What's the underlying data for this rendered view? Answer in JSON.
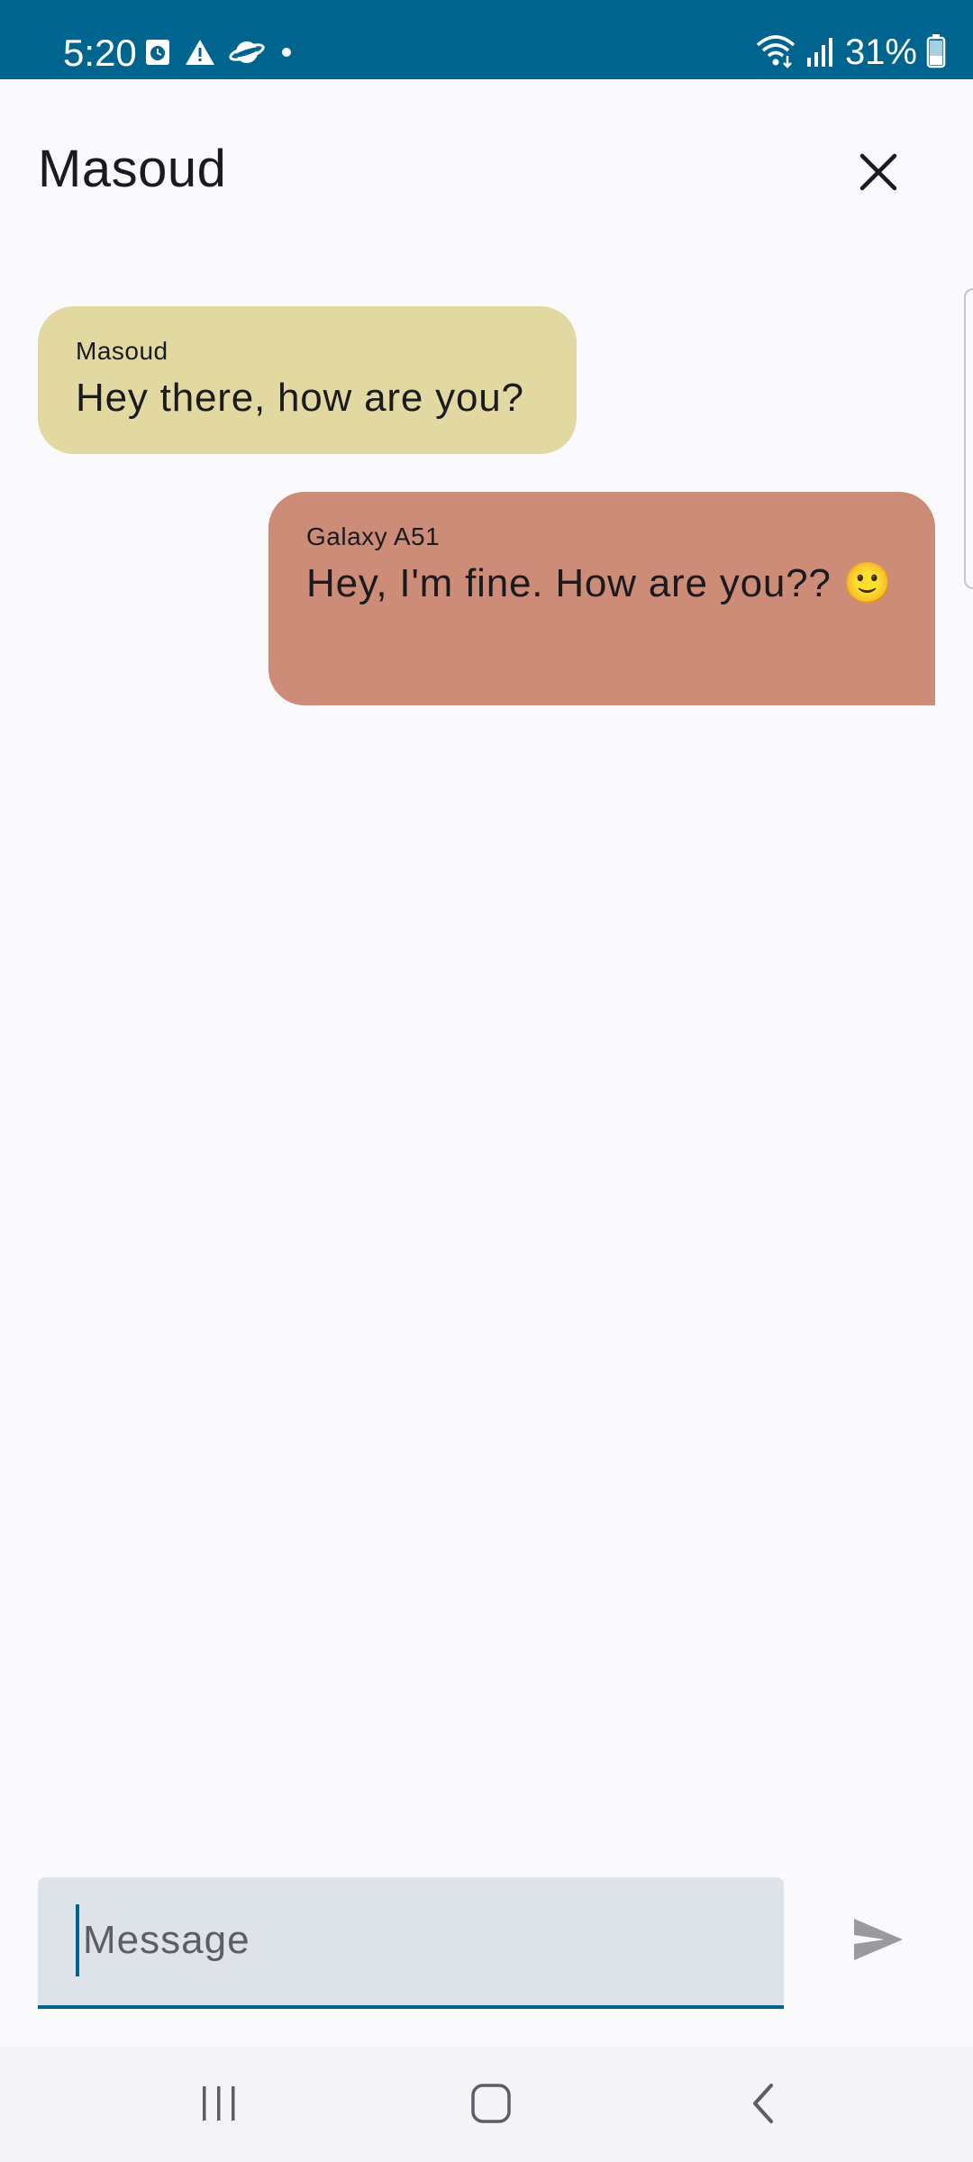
{
  "status_bar": {
    "time": "5:20",
    "battery": "31%",
    "icons_left": [
      "clock-app-icon",
      "warning-icon",
      "planet-icon",
      "dot-icon"
    ],
    "icons_right": [
      "wifi-icon",
      "signal-icon",
      "battery-icon"
    ]
  },
  "header": {
    "title": "Masoud",
    "close_icon": "close-icon"
  },
  "messages": [
    {
      "sender": "Masoud",
      "text": "Hey there, how are you?",
      "direction": "incoming",
      "color": "#e1d9a1"
    },
    {
      "sender": "Galaxy A51",
      "text": "Hey, I'm fine. How are you?? 🙂",
      "direction": "outgoing",
      "color": "#cd8c77"
    }
  ],
  "composer": {
    "value": "",
    "placeholder": "Message",
    "send_icon": "send-icon"
  },
  "nav_bar": {
    "buttons": [
      "recents-icon",
      "home-icon",
      "back-icon"
    ]
  },
  "colors": {
    "accent": "#00658e",
    "background": "#fafafd"
  }
}
